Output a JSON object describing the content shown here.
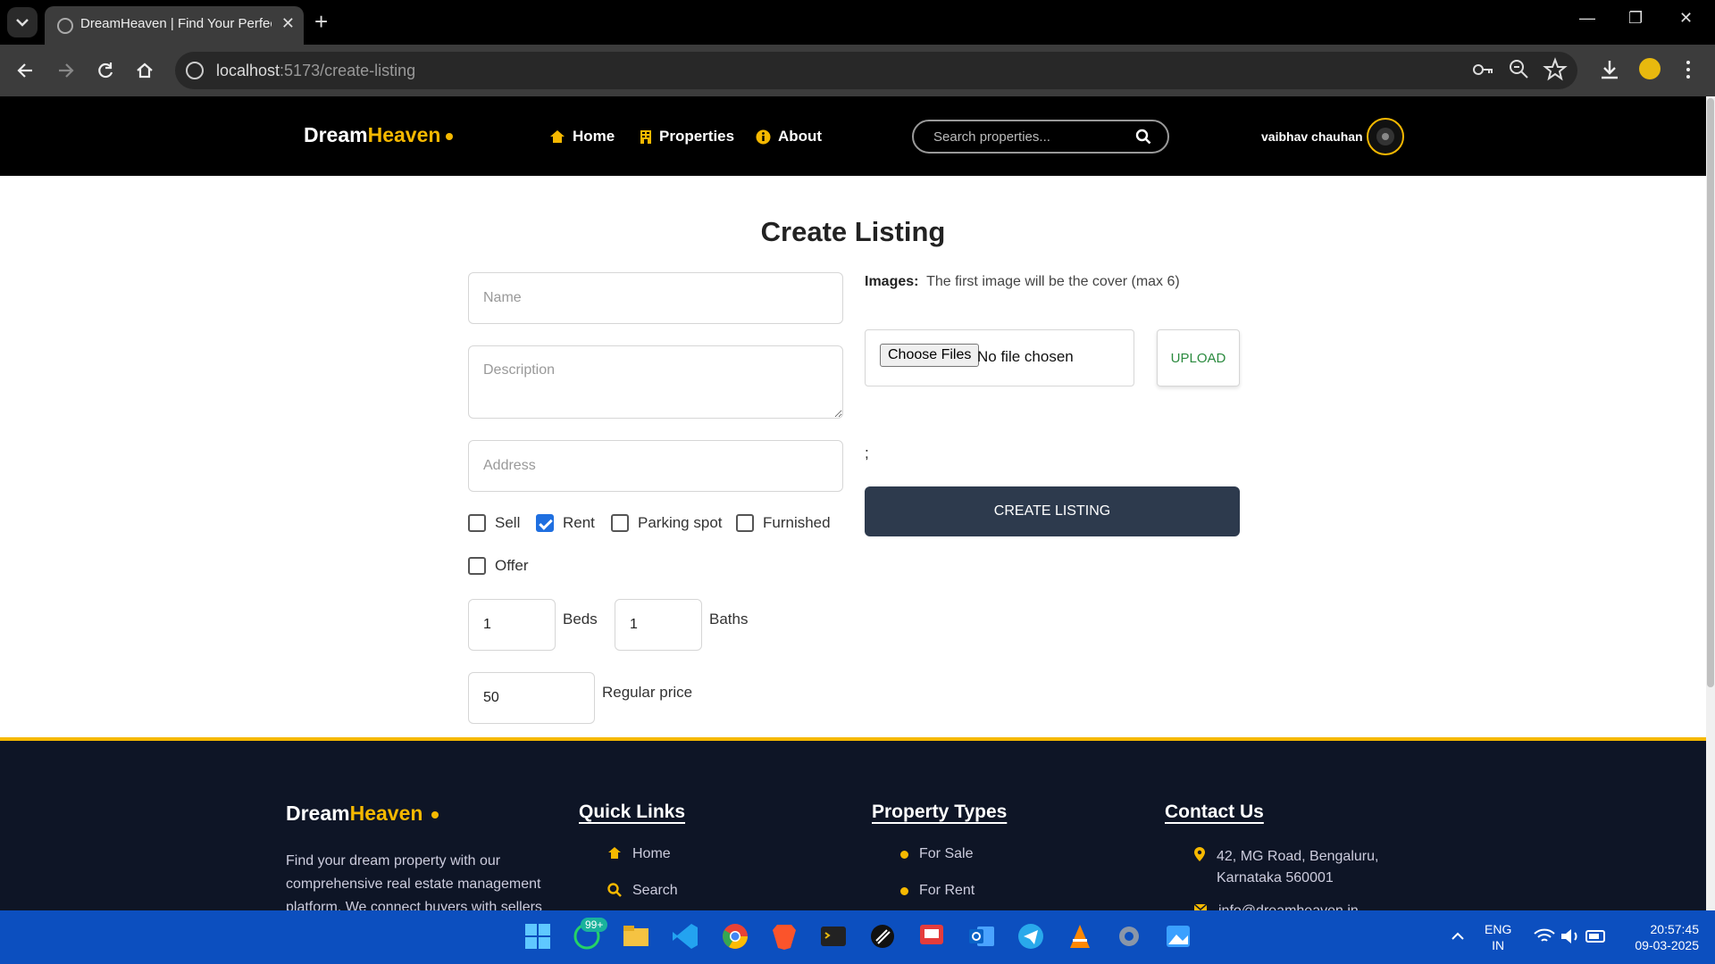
{
  "browser": {
    "tab_title": "DreamHeaven | Find Your Perfect",
    "url_host": "localhost",
    "url_path": ":5173/create-listing"
  },
  "header": {
    "logo_main": "Dream",
    "logo_accent": "Heaven",
    "nav": [
      {
        "label": "Home",
        "icon": "home-icon"
      },
      {
        "label": "Properties",
        "icon": "building-icon"
      },
      {
        "label": "About",
        "icon": "info-icon"
      }
    ],
    "search_placeholder": "Search properties...",
    "username": "vaibhav chauhan"
  },
  "form": {
    "title": "Create Listing",
    "name_placeholder": "Name",
    "description_placeholder": "Description",
    "address_placeholder": "Address",
    "checkboxes": [
      {
        "label": "Sell",
        "checked": false
      },
      {
        "label": "Rent",
        "checked": true
      },
      {
        "label": "Parking spot",
        "checked": false
      },
      {
        "label": "Furnished",
        "checked": false
      },
      {
        "label": "Offer",
        "checked": false
      }
    ],
    "beds_value": "1",
    "beds_label": "Beds",
    "baths_value": "1",
    "baths_label": "Baths",
    "price_value": "50",
    "price_label": "Regular price",
    "images_label": "Images:",
    "images_hint": "The first image will be the cover (max 6)",
    "choose_files": "Choose Files",
    "no_file": "No file chosen",
    "upload": "UPLOAD",
    "stray_text": ";",
    "create_button": "CREATE LISTING"
  },
  "footer": {
    "logo_main": "Dream",
    "logo_accent": "Heaven",
    "about_text": "Find your dream property with our comprehensive real estate management platform. We connect buyers with sellers",
    "quick_links_heading": "Quick Links",
    "quick_links": [
      {
        "label": "Home",
        "icon": "home-icon"
      },
      {
        "label": "Search",
        "icon": "search-icon"
      }
    ],
    "property_types_heading": "Property Types",
    "property_types": [
      "For Sale",
      "For Rent"
    ],
    "contact_heading": "Contact Us",
    "address": "42, MG Road, Bengaluru, Karnataka 560001",
    "email": "info@dreamheaven.in"
  },
  "taskbar": {
    "whatsapp_badge": "99+",
    "lang_1": "ENG",
    "lang_2": "IN",
    "time": "20:57:45",
    "date": "09-03-2025"
  },
  "colors": {
    "accent": "#f5b800",
    "button_dark": "#2d3a4d",
    "footer_bg": "#0e1526",
    "checkbox_blue": "#1f6fe0"
  }
}
